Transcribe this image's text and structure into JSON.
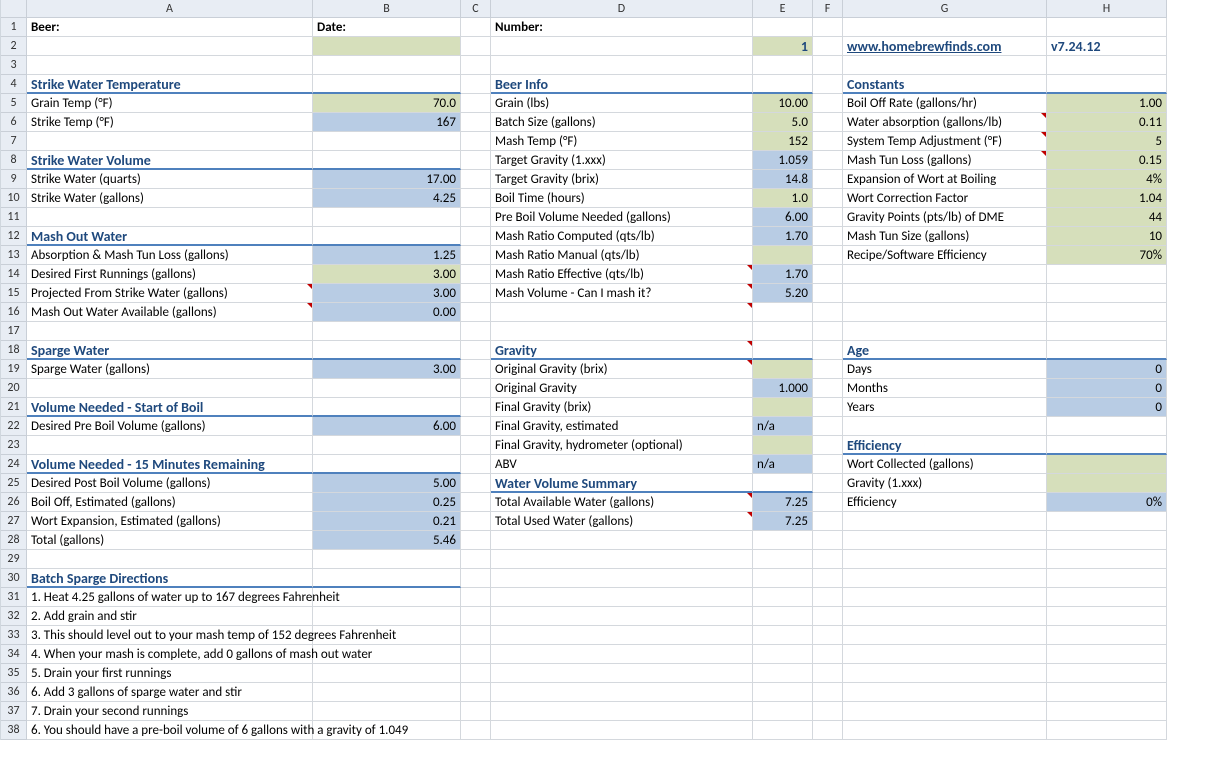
{
  "colHeaders": [
    "",
    "A",
    "B",
    "C",
    "D",
    "E",
    "F",
    "G",
    "H"
  ],
  "rows": [
    {
      "n": 1,
      "A": "Beer:",
      "Abold": true,
      "B": "Date:",
      "Bbold": true,
      "D": "Number:",
      "Dbold": true
    },
    {
      "n": 2,
      "Bfill": "olive",
      "E": "1",
      "Enum": true,
      "Efill": "olive",
      "G": "www.homebrewfinds.com",
      "Glink": true,
      "H": "v7.24.12",
      "Hver": true
    },
    {
      "n": 3
    },
    {
      "n": 4,
      "A": "Strike Water Temperature",
      "Asec": true,
      "Bsec": true,
      "D": "Beer Info",
      "Dsec": true,
      "Esec": true,
      "G": "Constants",
      "Gsec": true,
      "Hsec": true
    },
    {
      "n": 5,
      "A": "Grain Temp (°F)",
      "B": "70.0",
      "Bright": true,
      "Bfill": "olive",
      "D": "Grain (lbs)",
      "E": "10.00",
      "Eright": true,
      "Efill": "olive",
      "G": "Boil Off Rate (gallons/hr)",
      "H": "1.00",
      "Hright": true,
      "Hfill": "olive"
    },
    {
      "n": 6,
      "A": "Strike Temp (°F)",
      "B": "167",
      "Bright": true,
      "Bfill": "blue",
      "D": "Batch Size (gallons)",
      "E": "5.0",
      "Eright": true,
      "Efill": "olive",
      "G": "Water absorption (gallons/lb)",
      "H": "0.11",
      "Hright": true,
      "Hfill": "olive",
      "Gmark": true
    },
    {
      "n": 7,
      "D": "Mash Temp (°F)",
      "E": "152",
      "Eright": true,
      "Efill": "olive",
      "G": "System Temp Adjustment (°F)",
      "H": "5",
      "Hright": true,
      "Hfill": "olive",
      "Gmark": true
    },
    {
      "n": 8,
      "A": "Strike Water Volume",
      "Asec": true,
      "Bsec": true,
      "D": "Target Gravity (1.xxx)",
      "E": "1.059",
      "Eright": true,
      "Efill": "blue",
      "G": "Mash Tun Loss (gallons)",
      "H": "0.15",
      "Hright": true,
      "Hfill": "olive",
      "Gmark": true
    },
    {
      "n": 9,
      "A": "Strike Water (quarts)",
      "B": "17.00",
      "Bright": true,
      "Bfill": "blue",
      "D": "Target Gravity (brix)",
      "E": "14.8",
      "Eright": true,
      "Efill": "blue",
      "G": "Expansion of Wort at Boiling",
      "H": "4%",
      "Hright": true,
      "Hfill": "olive"
    },
    {
      "n": 10,
      "A": "Strike Water (gallons)",
      "B": "4.25",
      "Bright": true,
      "Bfill": "blue",
      "D": "Boil Time (hours)",
      "E": "1.0",
      "Eright": true,
      "Efill": "olive",
      "G": "Wort Correction Factor",
      "H": "1.04",
      "Hright": true,
      "Hfill": "olive"
    },
    {
      "n": 11,
      "D": "Pre Boil Volume Needed (gallons)",
      "E": "6.00",
      "Eright": true,
      "Efill": "blue",
      "G": "Gravity Points (pts/lb) of DME",
      "H": "44",
      "Hright": true,
      "Hfill": "olive"
    },
    {
      "n": 12,
      "A": "Mash Out Water",
      "Asec": true,
      "Bsec": true,
      "D": "Mash Ratio Computed  (qts/lb)",
      "E": "1.70",
      "Eright": true,
      "Efill": "blue",
      "G": "Mash Tun Size (gallons)",
      "H": "10",
      "Hright": true,
      "Hfill": "olive"
    },
    {
      "n": 13,
      "A": "Absorption & Mash Tun Loss (gallons)",
      "B": "1.25",
      "Bright": true,
      "Bfill": "blue",
      "D": "Mash Ratio Manual (qts/lb)",
      "Efill": "olive",
      "G": "Recipe/Software Efficiency",
      "H": "70%",
      "Hright": true,
      "Hfill": "olive"
    },
    {
      "n": 14,
      "A": "Desired First Runnings (gallons)",
      "B": "3.00",
      "Bright": true,
      "Bfill": "olive",
      "D": "Mash Ratio Effective (qts/lb)",
      "E": "1.70",
      "Eright": true,
      "Efill": "blue",
      "Dmark": true
    },
    {
      "n": 15,
      "A": "Projected From Strike Water (gallons)",
      "B": "3.00",
      "Bright": true,
      "Bfill": "blue",
      "D": "Mash Volume - Can I mash it?",
      "E": "5.20",
      "Eright": true,
      "Efill": "blue",
      "Amark": true,
      "Dmark": true
    },
    {
      "n": 16,
      "A": "Mash Out Water Available (gallons)",
      "B": "0.00",
      "Bright": true,
      "Bfill": "blue",
      "Amark": true,
      "Dmark": true
    },
    {
      "n": 17
    },
    {
      "n": 18,
      "A": "Sparge Water",
      "Asec": true,
      "Bsec": true,
      "D": "Gravity",
      "Dsec": true,
      "Esec": true,
      "G": "Age",
      "Gsec": true,
      "Hsec": true,
      "Dmark": true
    },
    {
      "n": 19,
      "A": "Sparge Water (gallons)",
      "B": "3.00",
      "Bright": true,
      "Bfill": "blue",
      "D": "Original Gravity (brix)",
      "Efill": "olive",
      "G": "Days",
      "H": "0",
      "Hright": true,
      "Hfill": "blue",
      "Dmark": true
    },
    {
      "n": 20,
      "D": "Original Gravity",
      "E": "1.000",
      "Eright": true,
      "Efill": "blue",
      "G": "Months",
      "H": "0",
      "Hright": true,
      "Hfill": "blue"
    },
    {
      "n": 21,
      "A": "Volume Needed - Start of Boil",
      "Asec": true,
      "Bsec": true,
      "D": "Final Gravity (brix)",
      "Efill": "olive",
      "G": "Years",
      "H": "0",
      "Hright": true,
      "Hfill": "blue"
    },
    {
      "n": 22,
      "A": "Desired Pre Boil Volume (gallons)",
      "B": "6.00",
      "Bright": true,
      "Bfill": "blue",
      "D": "Final Gravity, estimated",
      "E": "n/a",
      "Efill": "blue"
    },
    {
      "n": 23,
      "D": "Final Gravity, hydrometer (optional)",
      "Efill": "olive",
      "G": "Efficiency",
      "Gsec": true,
      "Hsec": true
    },
    {
      "n": 24,
      "A": "Volume Needed - 15 Minutes Remaining",
      "Asec": true,
      "Bsec": true,
      "D": "ABV",
      "E": "n/a",
      "Efill": "blue",
      "G": "Wort Collected (gallons)",
      "Hfill": "olive"
    },
    {
      "n": 25,
      "A": "Desired Post Boil Volume (gallons)",
      "B": "5.00",
      "Bright": true,
      "Bfill": "blue",
      "D": "Water Volume Summary",
      "Dsec": true,
      "Esec": true,
      "G": "Gravity (1.xxx)",
      "Hfill": "olive"
    },
    {
      "n": 26,
      "A": "Boil Off, Estimated  (gallons)",
      "B": "0.25",
      "Bright": true,
      "Bfill": "blue",
      "D": "Total Available Water (gallons)",
      "E": "7.25",
      "Eright": true,
      "Efill": "blue",
      "G": "Efficiency",
      "H": "0%",
      "Hright": true,
      "Hfill": "blue",
      "Dmark": true
    },
    {
      "n": 27,
      "A": "Wort Expansion, Estimated (gallons)",
      "B": "0.21",
      "Bright": true,
      "Bfill": "blue",
      "D": "Total Used Water (gallons)",
      "E": "7.25",
      "Eright": true,
      "Efill": "blue",
      "Dmark": true
    },
    {
      "n": 28,
      "A": "Total (gallons)",
      "B": "5.46",
      "Bright": true,
      "Bfill": "blue"
    },
    {
      "n": 29
    },
    {
      "n": 30,
      "A": "Batch Sparge Directions",
      "Asec": true,
      "Bsec": true
    },
    {
      "n": 31,
      "A": "1.  Heat 4.25 gallons of water up to 167 degrees Fahrenheit",
      "Aspan": true
    },
    {
      "n": 32,
      "A": "2.  Add grain and stir",
      "Aspan": true
    },
    {
      "n": 33,
      "A": "3.  This should level out to your mash temp of 152 degrees Fahrenheit",
      "Aspan": true
    },
    {
      "n": 34,
      "A": "4.  When your mash is complete, add 0 gallons of mash out water",
      "Aspan": true
    },
    {
      "n": 35,
      "A": "5.  Drain your first runnings",
      "Aspan": true
    },
    {
      "n": 36,
      "A": "6.  Add 3 gallons of sparge water and stir",
      "Aspan": true
    },
    {
      "n": 37,
      "A": "7.  Drain your second runnings",
      "Aspan": true
    },
    {
      "n": 38,
      "A": "6.  You should have a pre-boil volume of 6 gallons with a gravity of 1.049",
      "Aspan": true
    }
  ]
}
